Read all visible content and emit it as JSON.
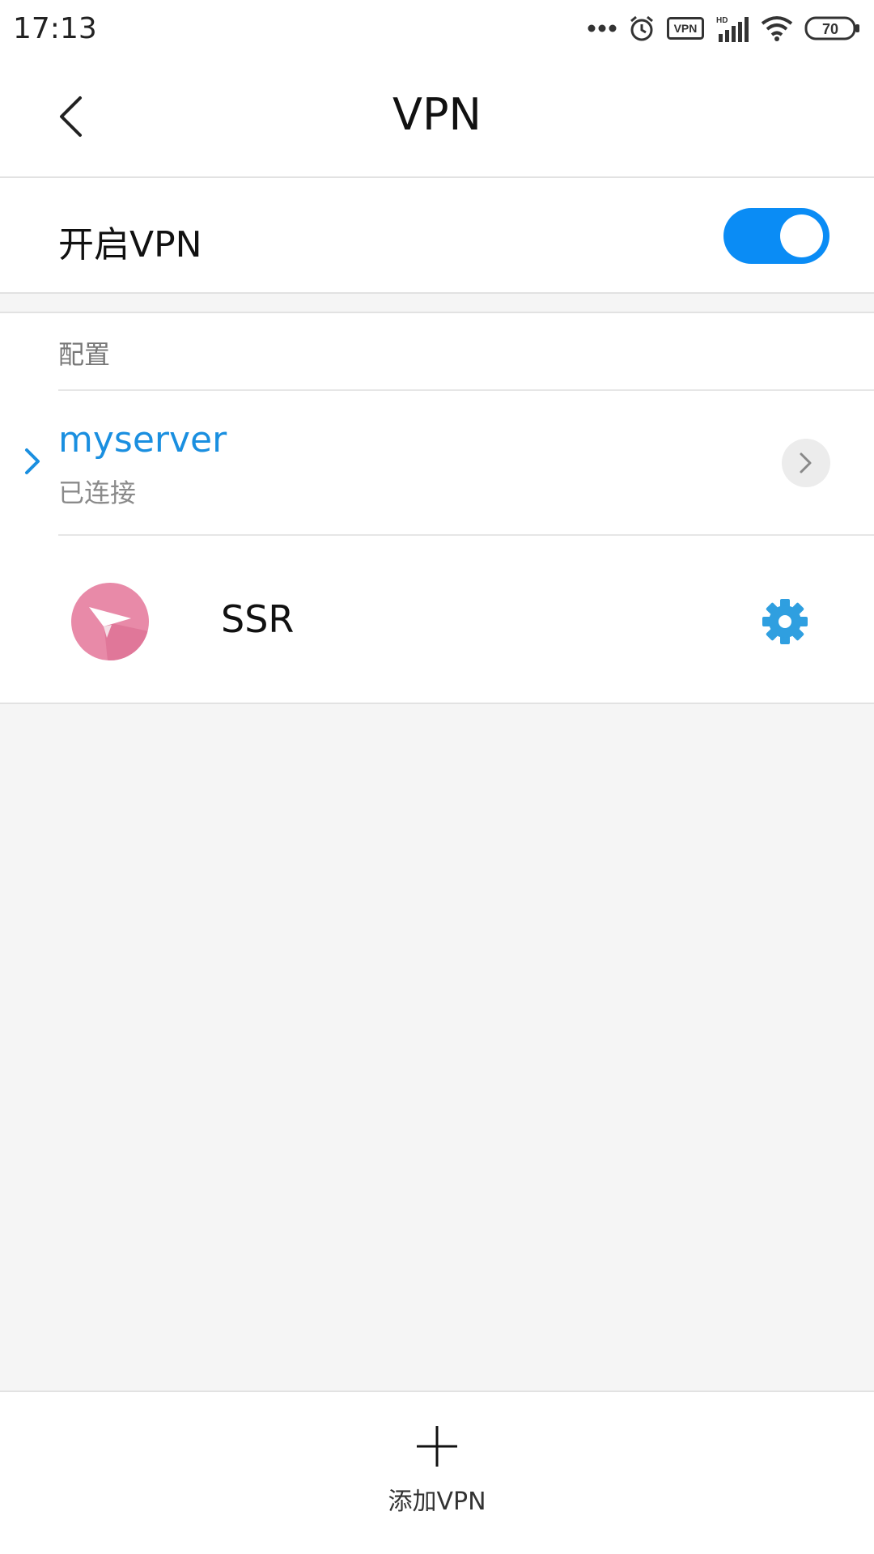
{
  "status_bar": {
    "time": "17:13",
    "battery": "70",
    "vpn_badge": "VPN",
    "hd_label": "HD",
    "icons": [
      "more-dots-icon",
      "alarm-icon",
      "vpn-badge-icon",
      "signal-icon",
      "wifi-icon",
      "battery-icon"
    ]
  },
  "header": {
    "title": "VPN",
    "back_icon": "chevron-left-icon"
  },
  "vpn_toggle": {
    "label": "开启VPN",
    "on": true,
    "accent": "#0a8cf5"
  },
  "config": {
    "section_title": "配置",
    "profiles": [
      {
        "name": "myserver",
        "status": "已连接",
        "selected": true,
        "accent": "#1a8fe0"
      }
    ],
    "apps": [
      {
        "label": "SSR",
        "icon": "paper-plane-icon",
        "settings_icon": "gear-icon",
        "icon_color": "#e88aa8",
        "settings_color": "#2f9fe0"
      }
    ]
  },
  "bottom": {
    "add_label": "添加VPN",
    "add_icon": "plus-icon"
  }
}
